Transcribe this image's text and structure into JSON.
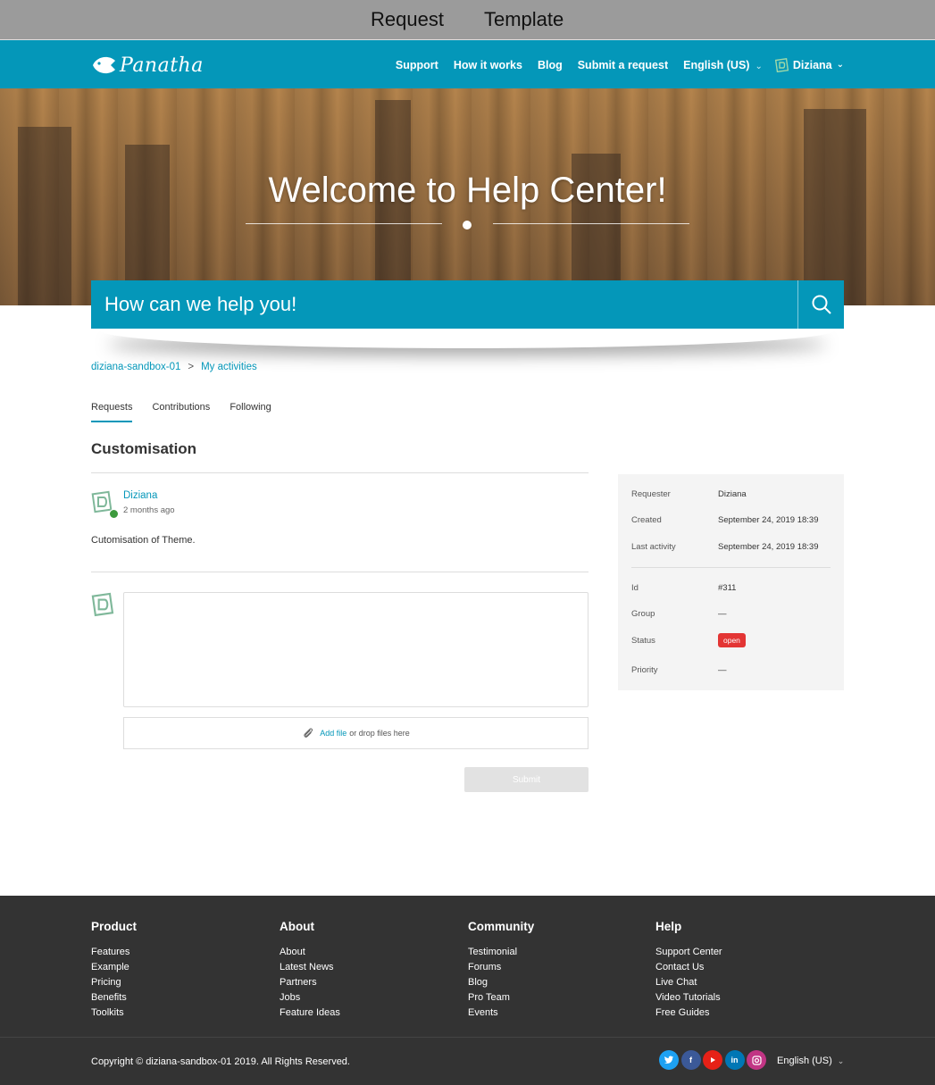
{
  "banner": {
    "word1": "Request",
    "word2": "Template"
  },
  "nav": {
    "logo_text": "Panatha",
    "links": [
      "Support",
      "How it works",
      "Blog",
      "Submit a request"
    ],
    "language": "English (US)",
    "user": "Diziana"
  },
  "hero": {
    "title": "Welcome to Help Center!"
  },
  "search": {
    "placeholder": "How can we help you!"
  },
  "breadcrumb": [
    "diziana-sandbox-01",
    ">",
    "My activities"
  ],
  "tabs": [
    "Requests",
    "Contributions",
    "Following"
  ],
  "request": {
    "title": "Customisation",
    "author": "Diziana",
    "time": "2 months ago",
    "body": "Cutomisation of Theme."
  },
  "reply": {
    "attach_link": "Add file",
    "attach_text": "or drop files here",
    "submit": "Submit"
  },
  "details": {
    "requester_label": "Requester",
    "requester": "Diziana",
    "created_label": "Created",
    "created": "September 24, 2019 18:39",
    "last_activity_label": "Last activity",
    "last_activity": "September 24, 2019 18:39",
    "id_label": "Id",
    "id": "#311",
    "group_label": "Group",
    "group": "—",
    "status_label": "Status",
    "status": "open",
    "priority_label": "Priority",
    "priority": "—"
  },
  "footer": {
    "columns": [
      {
        "title": "Product",
        "links": [
          "Features",
          "Example",
          "Pricing",
          "Benefits",
          "Toolkits"
        ]
      },
      {
        "title": "About",
        "links": [
          "About",
          "Latest News",
          "Partners",
          "Jobs",
          "Feature Ideas"
        ]
      },
      {
        "title": "Community",
        "links": [
          "Testimonial",
          "Forums",
          "Blog",
          "Pro Team",
          "Events"
        ]
      },
      {
        "title": "Help",
        "links": [
          "Support Center",
          "Contact Us",
          "Live Chat",
          "Video Tutorials",
          "Free Guides"
        ]
      }
    ],
    "copyright": "Copyright © diziana-sandbox-01 2019. All Rights Reserved.",
    "language": "English (US)",
    "socials": [
      {
        "icon": "twitter-icon",
        "color": "#1da1f2"
      },
      {
        "icon": "facebook-icon",
        "color": "#3b5998"
      },
      {
        "icon": "youtube-icon",
        "color": "#e62117"
      },
      {
        "icon": "linkedin-icon",
        "color": "#0077b5"
      },
      {
        "icon": "instagram-icon",
        "color": "#c13584"
      }
    ]
  },
  "colors": {
    "brand": "#0497b9",
    "status_open": "#e33534",
    "footer_bg": "#333333"
  }
}
